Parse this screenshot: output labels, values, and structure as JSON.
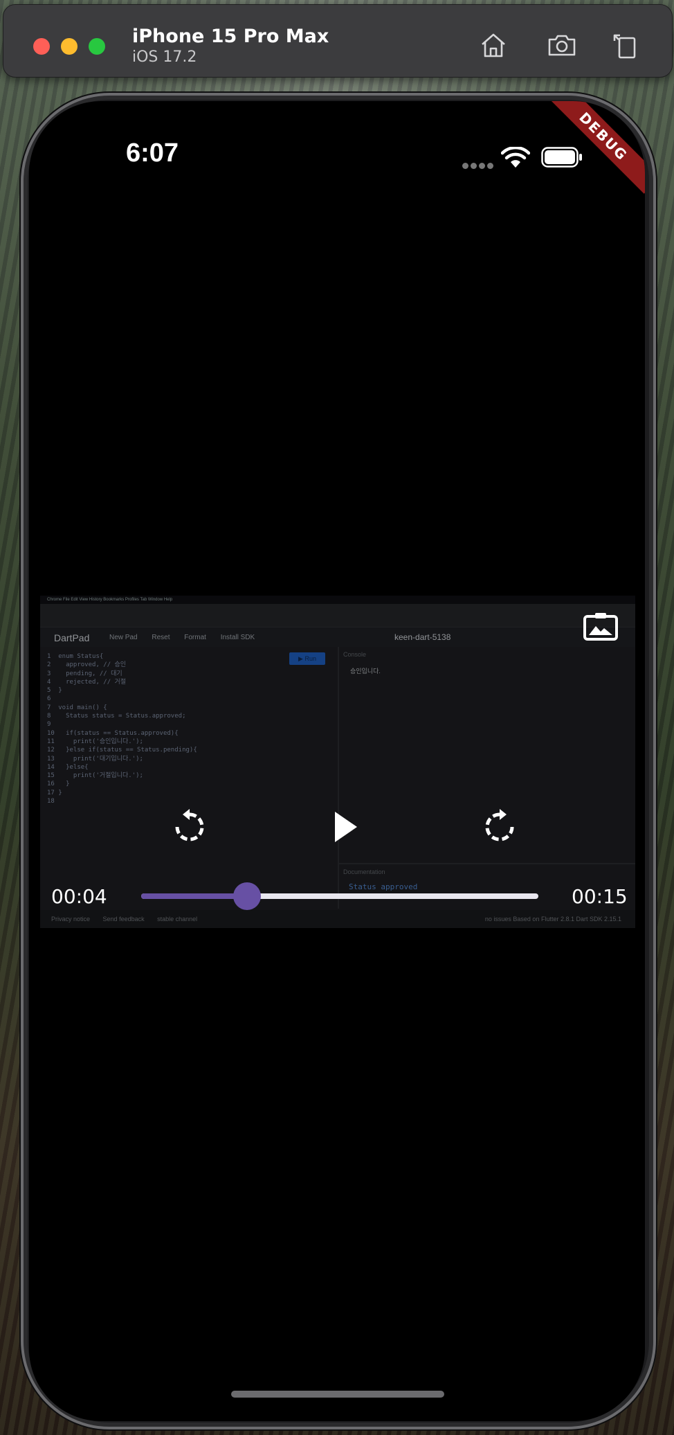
{
  "simulator": {
    "device_name": "iPhone 15 Pro Max",
    "os_version": "iOS 17.2"
  },
  "status_bar": {
    "time": "6:07"
  },
  "debug_banner": "DEBUG",
  "video_frame": {
    "mac_menu": "Chrome   File   Edit   View   History   Bookmarks   Profiles   Tab   Window   Help",
    "app_logo": "DartPad",
    "nav": [
      "New Pad",
      "Reset",
      "Format",
      "Install SDK"
    ],
    "pad_name": "keen-dart-5138",
    "run_label": "▶ Run",
    "code_lines": [
      "1  enum Status{",
      "2    approved, // 승인",
      "3    pending, // 대기",
      "4    rejected, // 거절",
      "5  }",
      "6",
      "7  void main() {",
      "8    Status status = Status.approved;",
      "9",
      "10   if(status == Status.approved){",
      "11     print('승인입니다.');",
      "12   }else if(status == Status.pending){",
      "13     print('대기입니다.');",
      "14   }else{",
      "15     print('거절입니다.');",
      "16   }",
      "17 }",
      "18"
    ],
    "console_label": "Console",
    "console_output": "승인입니다.",
    "documentation_label": "Documentation",
    "documentation_text": "Status approved",
    "footer_left": [
      "Privacy notice",
      "Send feedback",
      "stable channel"
    ],
    "footer_right": "no issues   Based on Flutter 2.8.1 Dart SDK 2.15.1"
  },
  "player": {
    "current_time": "00:04",
    "total_time": "00:15",
    "progress": 0.2667,
    "accent_color": "#6750a4"
  },
  "icons": {
    "home": "home-icon",
    "screenshot": "camera-icon",
    "rotate": "rotate-icon",
    "pip": "picture-in-picture-icon",
    "rewind": "replay-icon",
    "play": "play-icon",
    "forward": "forward-icon"
  }
}
